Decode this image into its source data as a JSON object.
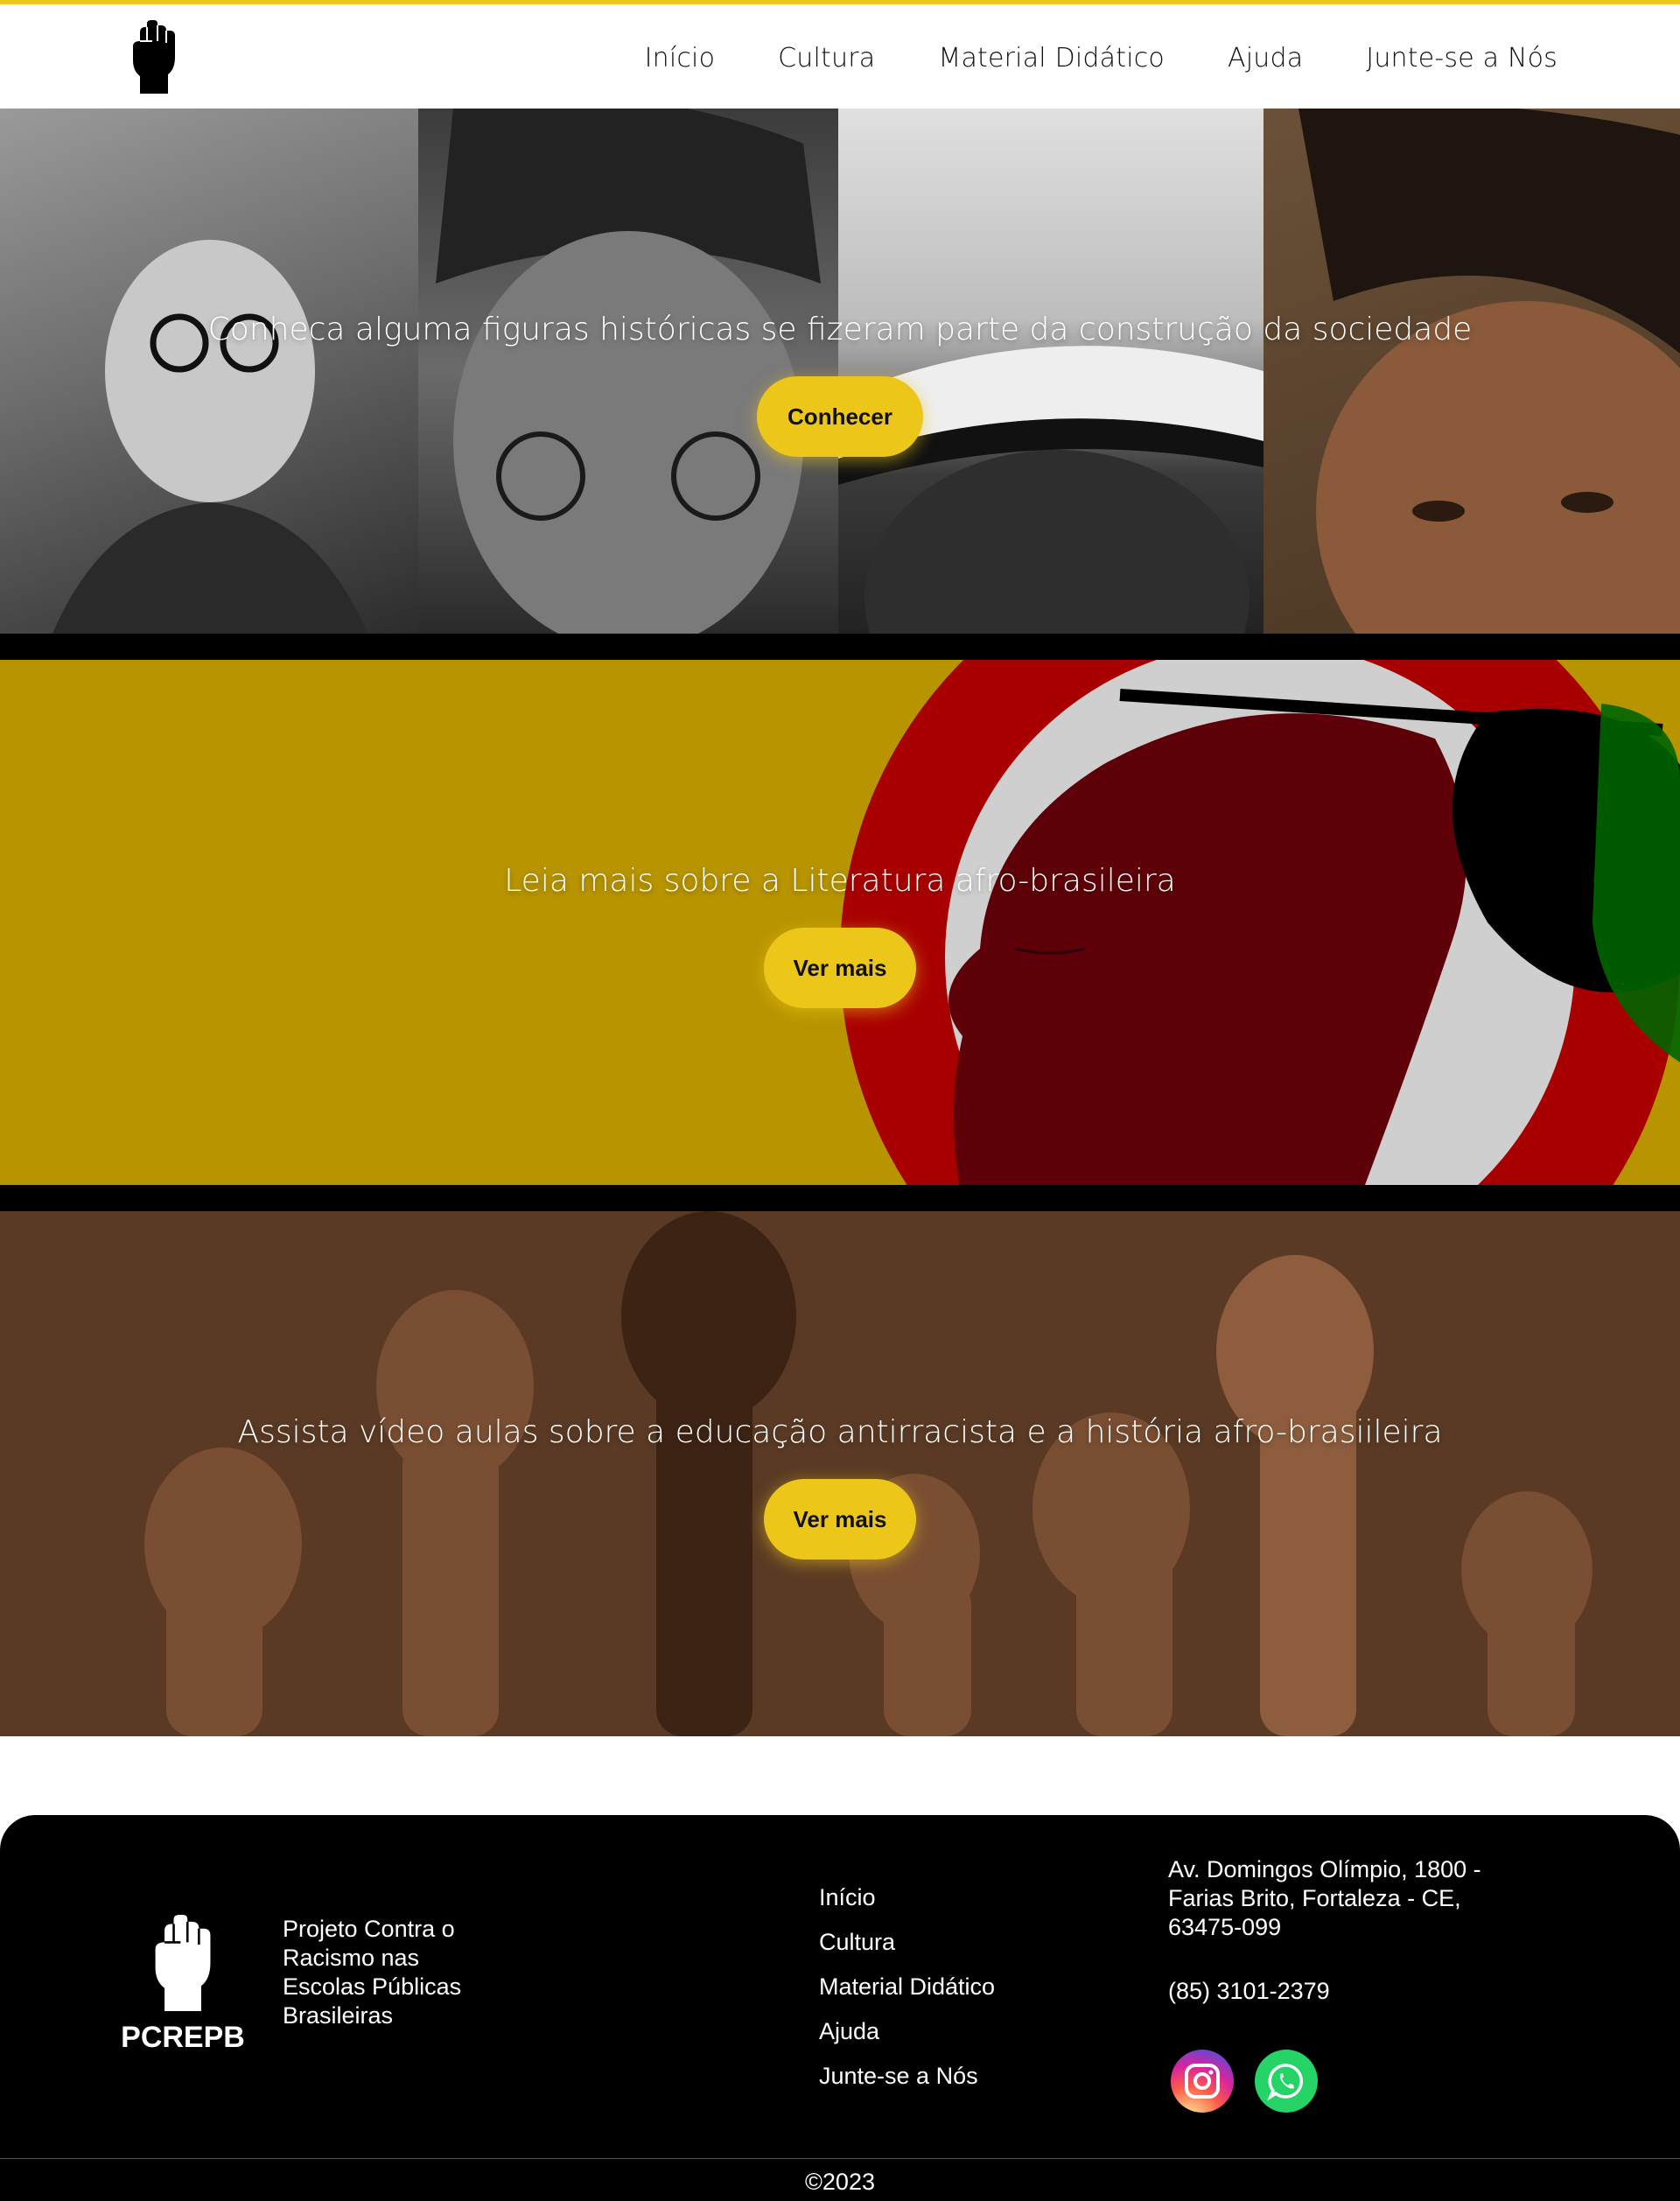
{
  "header": {
    "logo_icon": "raised-fist-icon",
    "nav": [
      "Início",
      "Cultura",
      "Material Didático",
      "Ajuda",
      "Junte-se a Nós"
    ]
  },
  "sections": [
    {
      "text": "Conheca alguma figuras históricas se fizeram parte da construção da sociedade",
      "button": "Conhecer"
    },
    {
      "text": "Leia mais sobre a Literatura afro-brasileira",
      "button": "Ver mais"
    },
    {
      "text": "Assista vídeo aulas sobre a educação antirracista e a história afro-brasiileira",
      "button": "Ver mais"
    }
  ],
  "footer": {
    "brand_name": "PCREPB",
    "tagline": "Projeto Contra o Racismo nas Escolas Públicas Brasileiras",
    "links": [
      "Início",
      "Cultura",
      "Material Didático",
      "Ajuda",
      "Junte-se a Nós"
    ],
    "address": "Av. Domingos Olímpio, 1800 - Farias Brito, Fortaleza - CE, 63475-099",
    "phone": "(85) 3101-2379",
    "social": [
      "instagram-icon",
      "whatsapp-icon"
    ],
    "copyright": "©2023"
  },
  "colors": {
    "accent": "#ecc71a",
    "literature_bg": "#b89400",
    "footer_bg": "#000000"
  }
}
